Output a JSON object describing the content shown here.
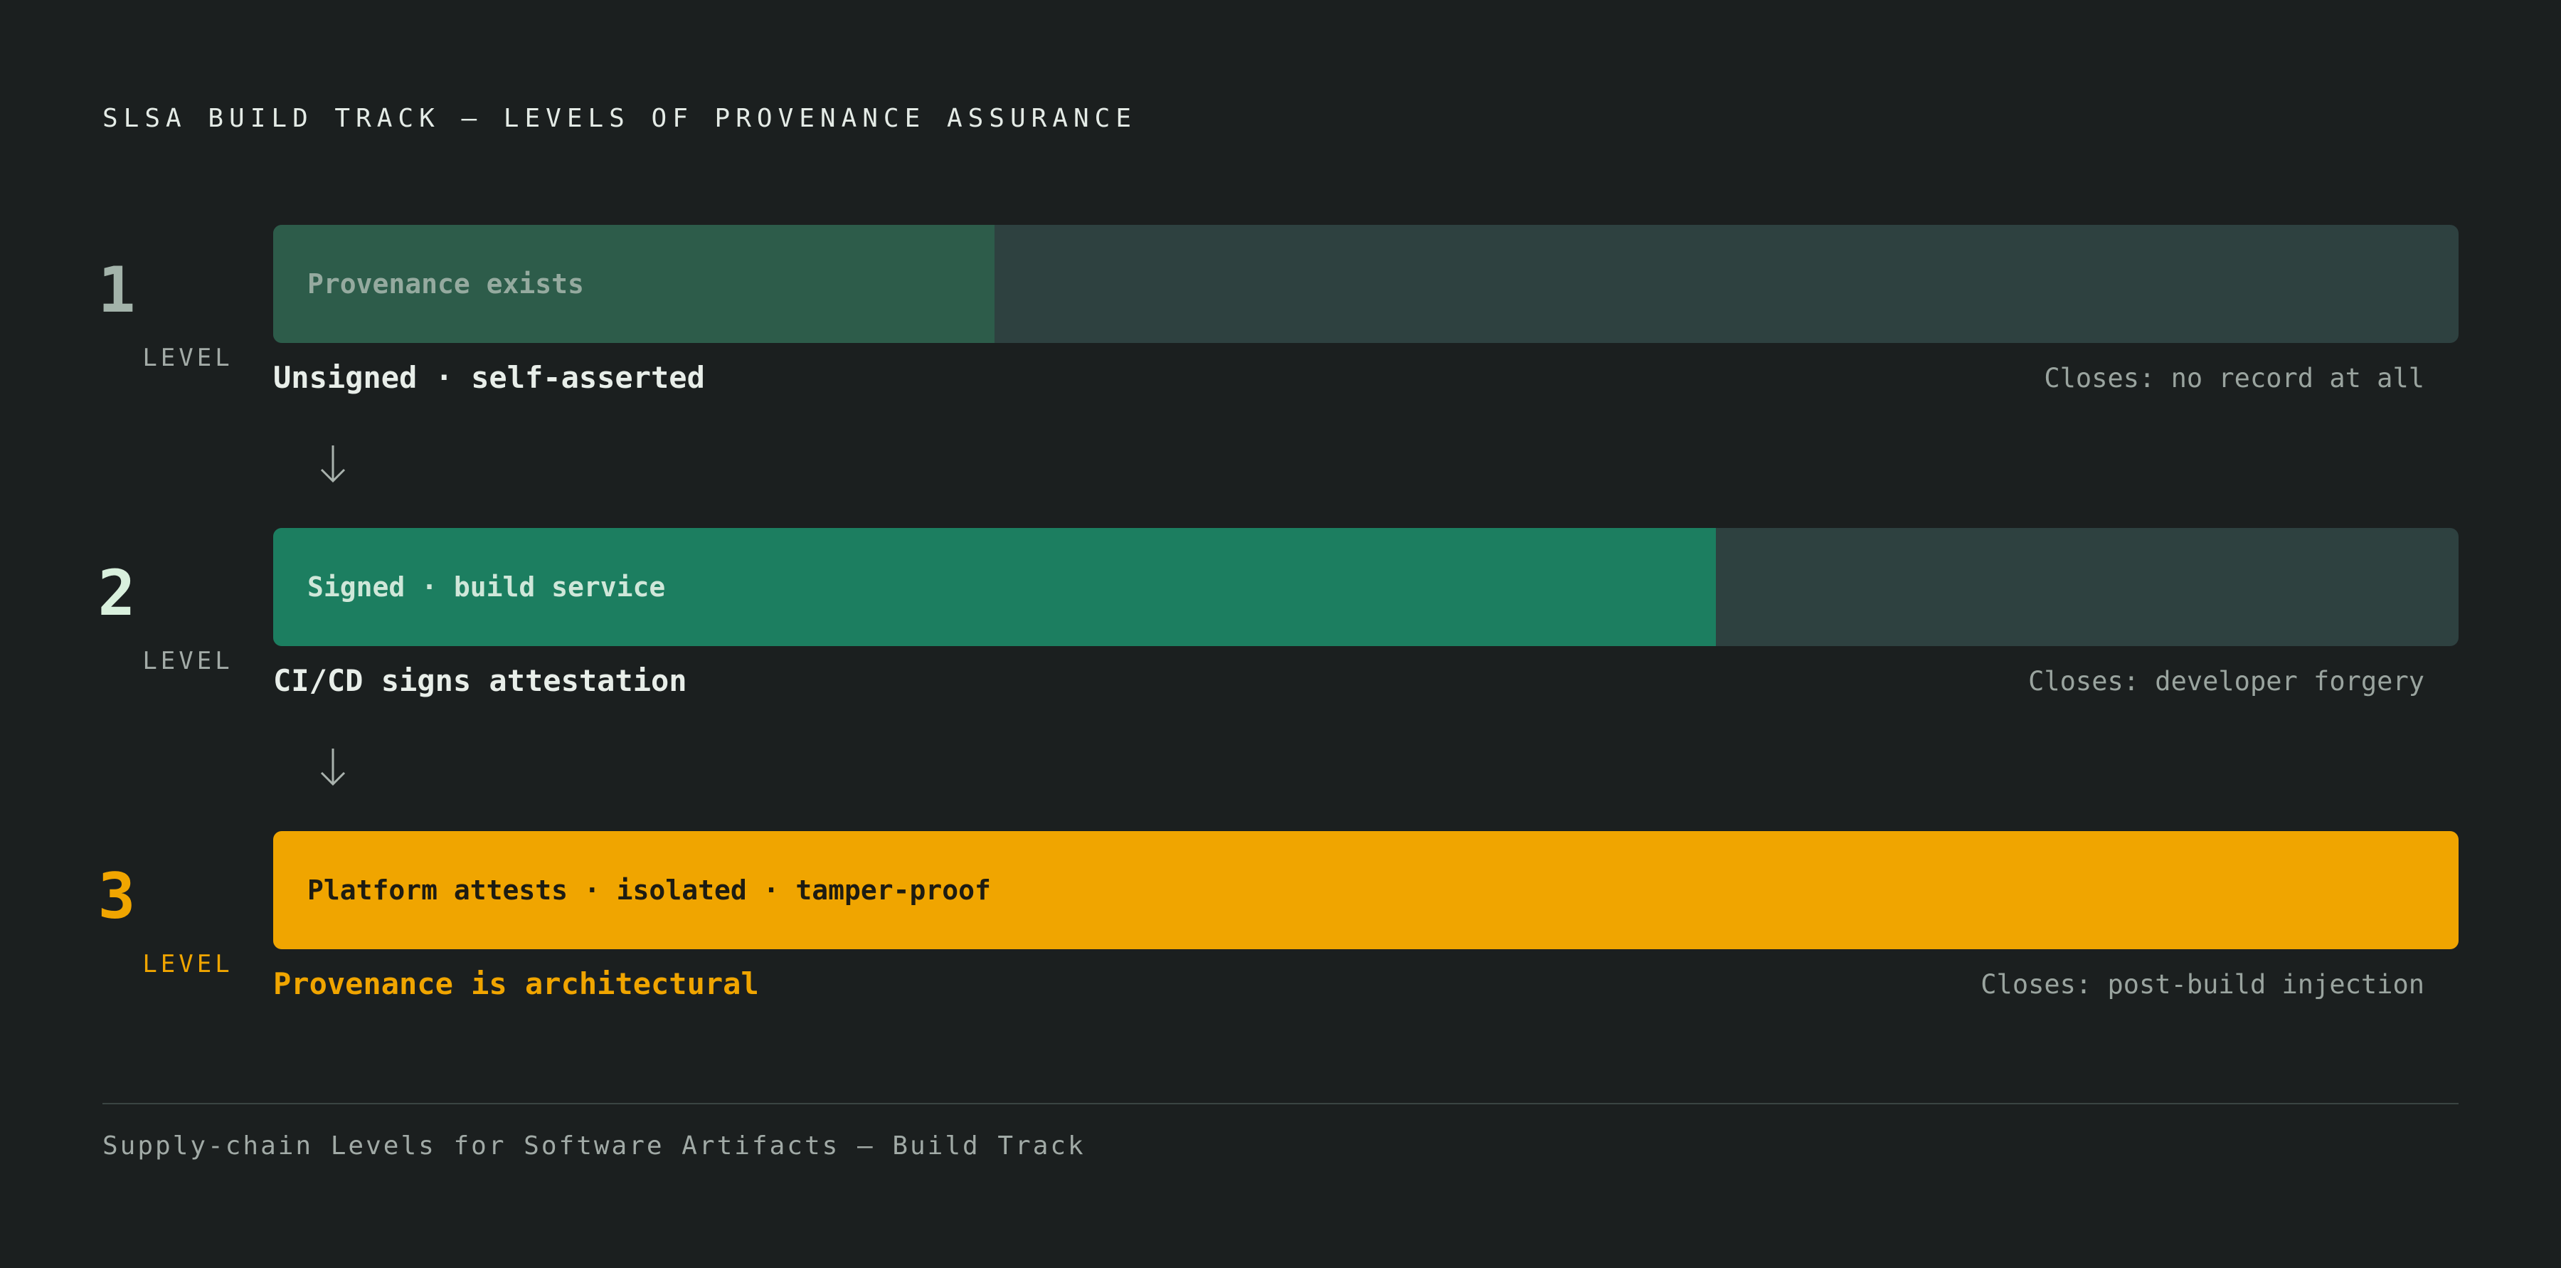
{
  "title": "SLSA BUILD TRACK — LEVELS OF PROVENANCE ASSURANCE",
  "levels": [
    {
      "number": "1",
      "word": "LEVEL",
      "bar_label": "Provenance exists",
      "fill_fraction": 0.33,
      "caption": "Unsigned · self-asserted",
      "closes": "Closes: no record at all",
      "fill_color": "#2d5c4a",
      "label_color": "#95aa9f",
      "number_color": "#a3b3aa",
      "word_color": "#a3aba7",
      "caption_color": "#e8eee9"
    },
    {
      "number": "2",
      "word": "LEVEL",
      "bar_label": "Signed · build service",
      "fill_fraction": 0.66,
      "caption": "CI/CD signs attestation",
      "closes": "Closes: developer forgery",
      "fill_color": "#1c7e60",
      "label_color": "#cfe7d9",
      "number_color": "#d9f0dd",
      "word_color": "#a3aba7",
      "caption_color": "#e8eee9"
    },
    {
      "number": "3",
      "word": "LEVEL",
      "bar_label": "Platform attests · isolated · tamper-proof",
      "fill_fraction": 1.0,
      "caption": "Provenance is architectural",
      "closes": "Closes: post-build injection",
      "fill_color": "#f0a500",
      "label_color": "#1e1c12",
      "number_color": "#f0a500",
      "word_color": "#f0a500",
      "caption_color": "#f0a500"
    }
  ],
  "arrow_icon": "arrow-down-icon",
  "track_color": "#2e4140",
  "footer": "Supply-chain Levels for Software Artifacts — Build Track"
}
